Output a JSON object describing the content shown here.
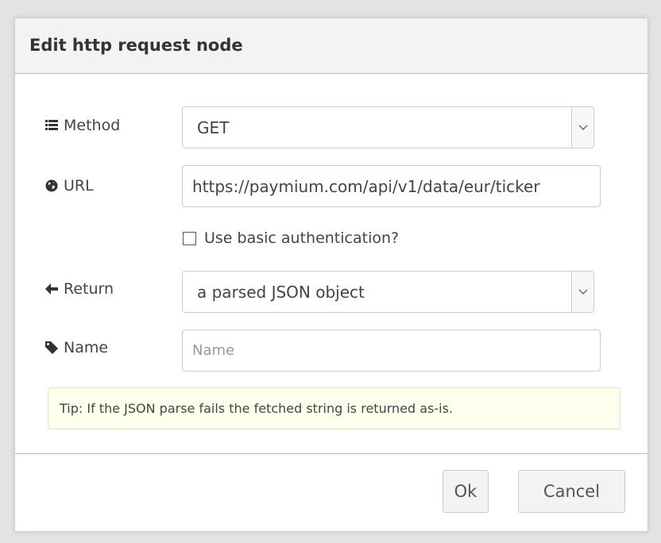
{
  "dialog": {
    "title": "Edit http request node"
  },
  "form": {
    "method": {
      "label": "Method",
      "icon": "list-icon",
      "value": "GET"
    },
    "url": {
      "label": "URL",
      "icon": "globe-icon",
      "value": "https://paymium.com/api/v1/data/eur/ticker"
    },
    "auth": {
      "label": "Use basic authentication?",
      "checked": false
    },
    "ret": {
      "label": "Return",
      "icon": "arrow-left-icon",
      "value": "a parsed JSON object"
    },
    "name": {
      "label": "Name",
      "icon": "tag-icon",
      "value": "",
      "placeholder": "Name"
    }
  },
  "tip": {
    "text": "Tip: If the JSON parse fails the fetched string is returned as-is."
  },
  "buttons": {
    "ok": "Ok",
    "cancel": "Cancel"
  }
}
